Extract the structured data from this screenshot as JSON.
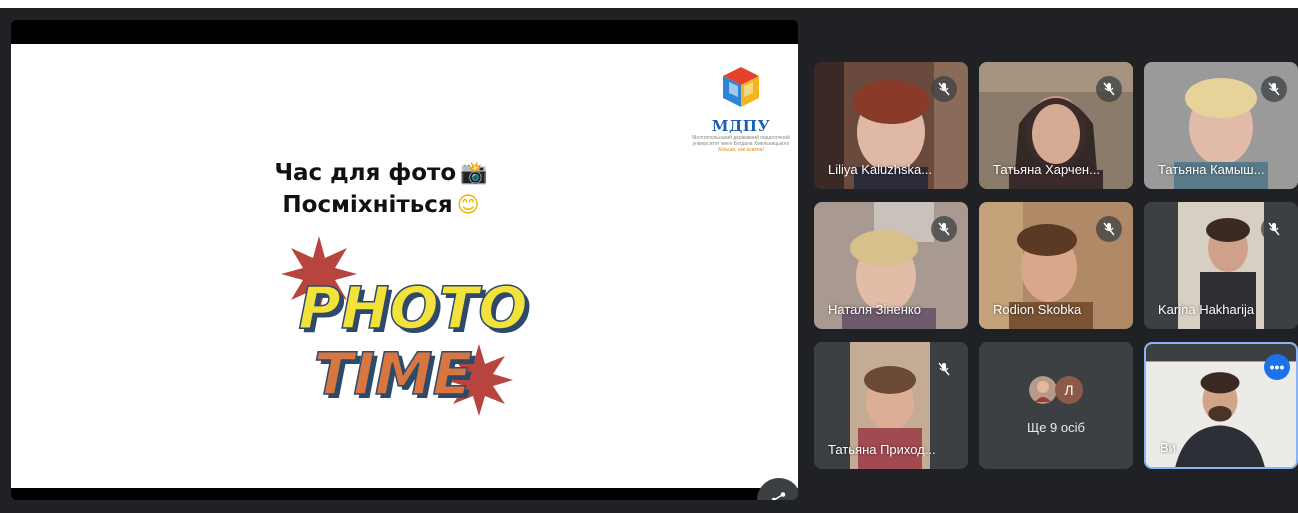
{
  "slide": {
    "line1": "Час для фото",
    "line2": "Посміхніться",
    "graphic_text_1": "PHOTO",
    "graphic_text_2": "TIME",
    "logo_title": "МДПУ",
    "logo_sub": "Мелітопольський державний педагогічний університет імені Богдана Хмельницького",
    "logo_tag": "Більше, ніж освіта!"
  },
  "participants": [
    {
      "name": "Liliya Kaluzhska...",
      "muted": true
    },
    {
      "name": "Татьяна Харчен...",
      "muted": true
    },
    {
      "name": "Татьяна Камыш...",
      "muted": true
    },
    {
      "name": "Наталя Зіненко",
      "muted": true
    },
    {
      "name": "Rodion Skobka",
      "muted": true
    },
    {
      "name": "Karina Hakharija",
      "muted": true
    },
    {
      "name": "Татьяна Приход...",
      "muted": true
    }
  ],
  "more": {
    "label": "Ще 9 осіб",
    "avatar_letter": "Л"
  },
  "self": {
    "name": "Ви"
  },
  "colors": {
    "background": "#202124",
    "tile": "#3c4043",
    "accent": "#1a73e8",
    "self_border": "#8ab4f8"
  }
}
